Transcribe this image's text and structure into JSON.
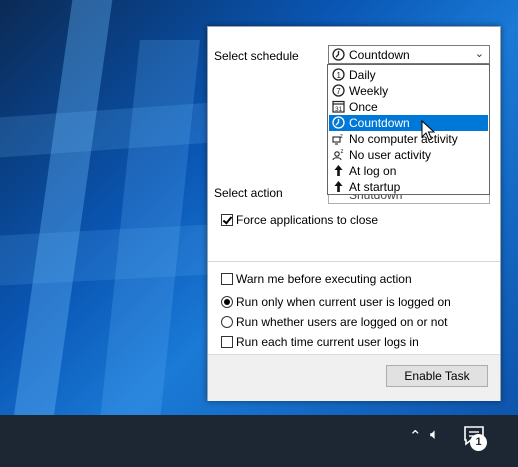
{
  "schedule": {
    "label": "Select  schedule",
    "selected": "Countdown",
    "options": [
      {
        "label": "Daily",
        "icon": "daily-icon"
      },
      {
        "label": "Weekly",
        "icon": "weekly-icon"
      },
      {
        "label": "Once",
        "icon": "calendar-icon"
      },
      {
        "label": "Countdown",
        "icon": "countdown-icon",
        "selected": true
      },
      {
        "label": "No computer activity",
        "icon": "computer-sleep-icon"
      },
      {
        "label": "No user activity",
        "icon": "user-sleep-icon"
      },
      {
        "label": "At log on",
        "icon": "arrow-up-icon"
      },
      {
        "label": "At startup",
        "icon": "arrow-up-icon"
      }
    ]
  },
  "action": {
    "label": "Select  action",
    "value": "Shutdown"
  },
  "options": {
    "force_close": {
      "label": "Force applications to close",
      "checked": true
    },
    "warn": {
      "label": "Warn me before executing action",
      "checked": false
    },
    "run_logged_on": {
      "label": "Run only when current user is logged on",
      "selected": true
    },
    "run_whether": {
      "label": "Run whether users are logged on or not",
      "selected": false
    },
    "run_each_logon": {
      "label": "Run each time current user logs in",
      "checked": false
    }
  },
  "enable_button": "Enable Task",
  "taskbar": {
    "notification_count": "1"
  },
  "colors": {
    "selection": "#0078d7",
    "taskbar": "#1c2733",
    "desktop": "#0a56b4"
  }
}
